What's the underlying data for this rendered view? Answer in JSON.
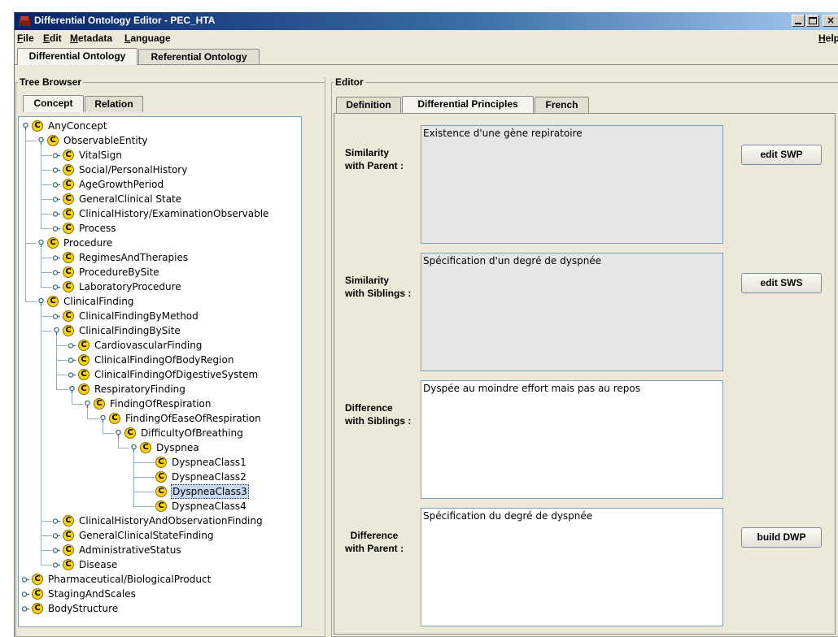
{
  "window": {
    "title": "Differential Ontology Editor - PEC_HTA",
    "help_label": "Help"
  },
  "menu": {
    "items": [
      "File",
      "Edit",
      "Metadata",
      "Language"
    ]
  },
  "main_tabs": [
    "Differential Ontology",
    "Referential Ontology"
  ],
  "left_panel": {
    "title": "Tree Browser",
    "tabs": [
      "Concept",
      "Relation"
    ]
  },
  "tree": [
    {
      "label": "AnyConcept"
    },
    {
      "label": "ObservableEntity"
    },
    {
      "label": "VitalSign"
    },
    {
      "label": "Social/PersonalHistory"
    },
    {
      "label": "AgeGrowthPeriod"
    },
    {
      "label": "GeneralClinical State"
    },
    {
      "label": "ClinicalHistory/ExaminationObservable"
    },
    {
      "label": "Process"
    },
    {
      "label": "Procedure"
    },
    {
      "label": "RegimesAndTherapies"
    },
    {
      "label": "ProcedureBySite"
    },
    {
      "label": "LaboratoryProcedure"
    },
    {
      "label": "ClinicalFinding"
    },
    {
      "label": "ClinicalFindingByMethod"
    },
    {
      "label": "ClinicalFindingBySite"
    },
    {
      "label": "CardiovascularFinding"
    },
    {
      "label": "ClinicalFindingOfBodyRegion"
    },
    {
      "label": "ClinicalFindingOfDigestiveSystem"
    },
    {
      "label": "RespiratoryFinding"
    },
    {
      "label": "FindingOfRespiration"
    },
    {
      "label": "FindingOfEaseOfRespiration"
    },
    {
      "label": "DifficultyOfBreathing"
    },
    {
      "label": "Dyspnea"
    },
    {
      "label": "DyspneaClass1"
    },
    {
      "label": "DyspneaClass2"
    },
    {
      "label": "DyspneaClass3"
    },
    {
      "label": "DyspneaClass4"
    },
    {
      "label": "ClinicalHistoryAndObservationFinding"
    },
    {
      "label": "GeneralClinicalStateFinding"
    },
    {
      "label": "AdministrativeStatus"
    },
    {
      "label": "Disease"
    },
    {
      "label": "Pharmaceutical/BiologicalProduct"
    },
    {
      "label": "StagingAndScales"
    },
    {
      "label": "BodyStructure"
    }
  ],
  "concept_icon_letter": "C",
  "editor": {
    "title": "Editor",
    "tabs": [
      "Definition",
      "Differential Principles",
      "French"
    ],
    "fields": [
      {
        "label_line1": "Similarity",
        "label_line2": "with Parent :",
        "text": "Existence d'une gène repiratoire",
        "button": "edit SWP"
      },
      {
        "label_line1": "Similarity",
        "label_line2": "with Siblings :",
        "text": "Spécification d'un degré de dyspnée",
        "button": "edit SWS"
      },
      {
        "label_line1": "Difference",
        "label_line2": "with Siblings :",
        "text": "Dyspée au moindre effort mais pas au repos",
        "button": ""
      },
      {
        "label_line1": "Difference",
        "label_line2": "with Parent :",
        "text": "Spécification du degré de dyspnée",
        "button": "build DWP"
      }
    ]
  },
  "colors": {
    "selection": "#c7d9f0",
    "concept_icon": "#f6d200",
    "titlebar": "#0a246a"
  }
}
